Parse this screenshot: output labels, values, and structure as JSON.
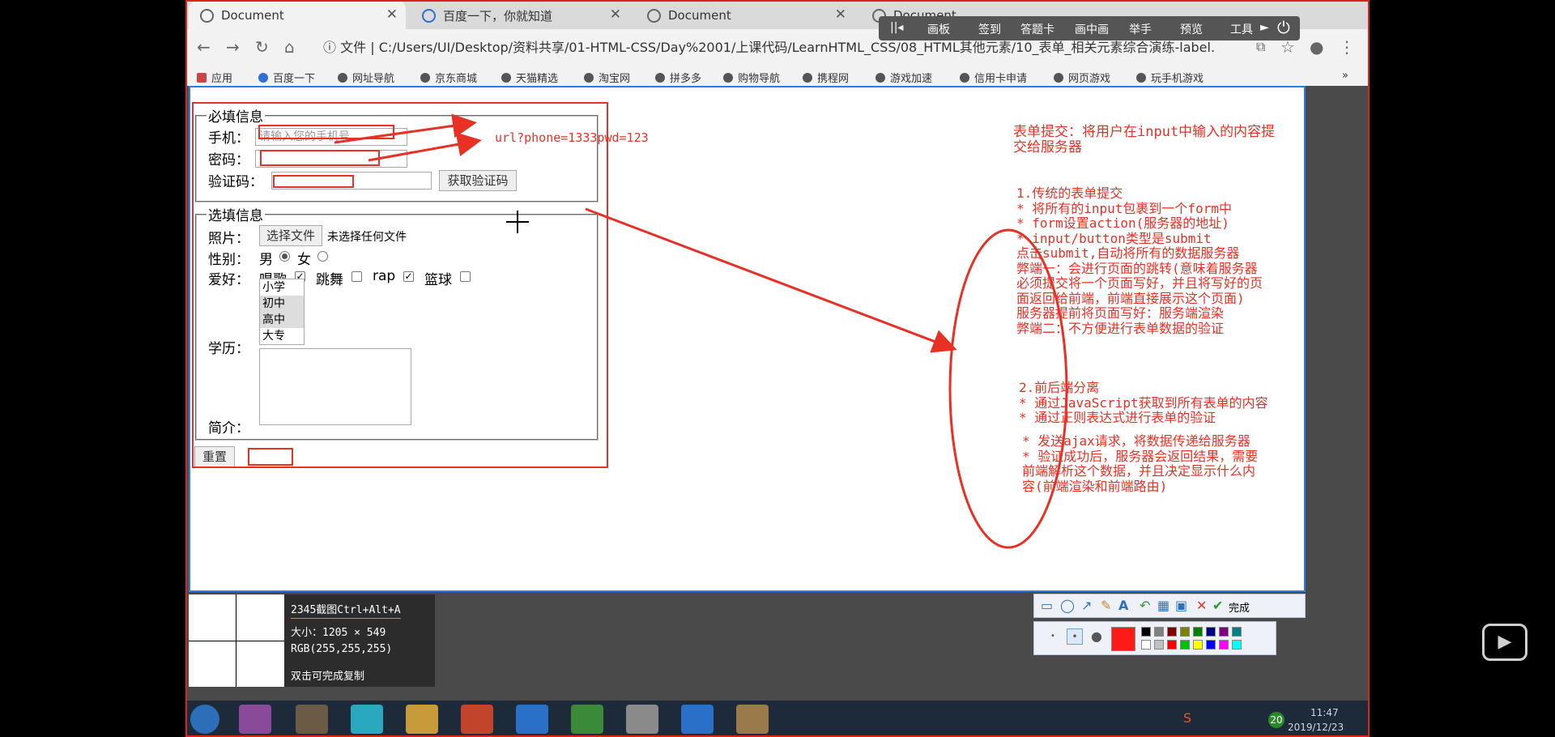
{
  "browser": {
    "tabs": [
      {
        "label": "Document"
      },
      {
        "label": "百度一下，你就知道"
      },
      {
        "label": "Document"
      },
      {
        "label": "Document"
      }
    ],
    "address": "C:/Users/UI/Desktop/资料共享/01-HTML-CSS/Day%2001/上课代码/LearnHTML_CSS/08_HTML其他元素/10_表单_相关元素综合演练-label....",
    "address_prefix": "文件",
    "bookmarks": [
      "应用",
      "百度一下",
      "网址导航",
      "京东商城",
      "天猫精选",
      "淘宝网",
      "拼多多",
      "购物导航",
      "携程网",
      "游戏加速",
      "信用卡申请",
      "网页游戏",
      "玩手机游戏"
    ],
    "float_toolbar": [
      "画板",
      "签到",
      "答题卡",
      "画中画",
      "举手",
      "预览",
      "工具"
    ]
  },
  "form": {
    "required_legend": "必填信息",
    "phone_label": "手机：",
    "phone_placeholder": "请输入您的手机号",
    "password_label": "密码：",
    "code_label": "验证码：",
    "get_code_button": "获取验证码",
    "optional_legend": "选填信息",
    "photo_label": "照片：",
    "choose_file_button": "选择文件",
    "no_file_text": "未选择任何文件",
    "gender_label": "性别：",
    "male": "男",
    "female": "女",
    "hobby_label": "爱好：",
    "hobbies": [
      {
        "label": "唱歌",
        "checked": true
      },
      {
        "label": "跳舞",
        "checked": false
      },
      {
        "label": "rap",
        "checked": true
      },
      {
        "label": "篮球",
        "checked": false
      }
    ],
    "education_label": "学历：",
    "education_options": [
      "小学",
      "初中",
      "高中",
      "大专"
    ],
    "intro_label": "简介：",
    "reset_button": "重置"
  },
  "annotations": {
    "url_note": "url?phone=1333pwd=123",
    "title": [
      "表单提交：将用户在input中输入的内容提",
      "交给服务器"
    ],
    "section1": [
      "1.传统的表单提交",
      "* 将所有的input包裹到一个form中",
      "* form设置action(服务器的地址)",
      "* input/button类型是submit",
      "点击submit,自动将所有的数据服务器",
      "弊端一：会进行页面的跳转(意味着服务器",
      "必须提交将一个页面写好，并且将写好的页",
      "面返回给前端，前端直接展示这个页面)",
      "服务器提前将页面写好：服务端渲染",
      "弊端二：不方便进行表单数据的验证"
    ],
    "section2": [
      "2.前后端分离",
      "* 通过JavaScript获取到所有表单的内容",
      "* 通过正则表达式进行表单的验证"
    ],
    "section3": [
      "* 发送ajax请求，将数据传递给服务器",
      "* 验证成功后，服务器会返回结果，需要",
      "前端解析这个数据，并且决定显示什么内",
      "容(前端渲染和前端路由)"
    ]
  },
  "capture_tool": {
    "title": "2345截图Ctrl+Alt+A",
    "size": "大小：1205 × 549",
    "rgb": "RGB(255,255,255)",
    "hint": "双击可完成复制",
    "done": "完成"
  },
  "taskbar": {
    "time": "11:47",
    "date": "2019/12/23",
    "badge": "20"
  },
  "colors": {
    "annotation_red": "#e83025",
    "selection_blue": "#2d7de0"
  }
}
